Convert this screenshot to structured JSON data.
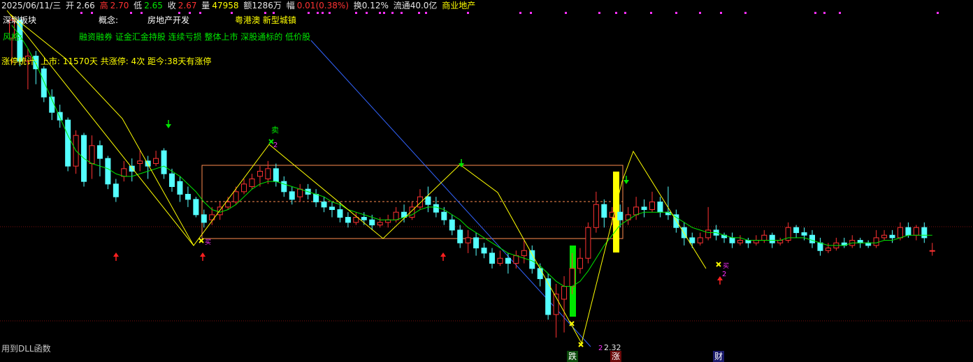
{
  "header": {
    "date": "2025/06/11/三",
    "open_label": "开",
    "open": "2.66",
    "high_label": "高",
    "high": "2.70",
    "low_label": "低",
    "low": "2.65",
    "close_label": "收",
    "close": "2.67",
    "vol_label": "量",
    "vol": "47958",
    "amount": "额1286万",
    "change_label": "幅",
    "change": "0.01(0.38%)",
    "turnover": "换0.12%",
    "float_cap": "流通40.0亿",
    "industry": "商业地产"
  },
  "info": {
    "region_label": "深圳板块",
    "concept_label": "概念:",
    "concept1": "房地产开发",
    "concept2": "粤港澳 新型城镇",
    "style_label": "风格:",
    "style_items": "融资融券 证金汇金持股 连续亏损 整体上市 深股通标的 低价股",
    "stats": "涨停统计: 上市: 11570天   共涨停: 4次   距今:38天有涨停"
  },
  "bottom_left": "用到DLL函数",
  "signals": {
    "sell": "卖",
    "buy": "买",
    "count2": "2",
    "low_price": "2.32"
  },
  "events": [
    {
      "label": "跌",
      "color": "#00c800"
    },
    {
      "label": "涨",
      "color": "#ff2020"
    },
    {
      "label": "财",
      "color": "#4060ff"
    }
  ],
  "colors": {
    "up": "#ff3232",
    "down": "#54ffff",
    "ma": "#00e600",
    "zigzag": "#ffff00",
    "box": "#ff8c50",
    "trend": "#3264ff",
    "arrow_up": "#ff2020",
    "arrow_down": "#00e600"
  },
  "chart_data": {
    "type": "candlestick",
    "date_last": "2025/06/11",
    "candles": [
      [
        3.5,
        3.57,
        3.59,
        3.4
      ],
      [
        3.57,
        3.41,
        3.58,
        3.39
      ],
      [
        3.41,
        3.43,
        3.46,
        3.3
      ],
      [
        3.43,
        3.38,
        3.45,
        3.32
      ],
      [
        3.38,
        3.27,
        3.39,
        3.25
      ],
      [
        3.27,
        3.21,
        3.3,
        3.18
      ],
      [
        3.21,
        3.18,
        3.24,
        3.15
      ],
      [
        3.18,
        3.0,
        3.19,
        2.98
      ],
      [
        3.0,
        3.12,
        3.14,
        2.97
      ],
      [
        3.12,
        2.94,
        3.13,
        2.92
      ],
      [
        3.01,
        3.08,
        3.12,
        2.95
      ],
      [
        3.08,
        3.03,
        3.1,
        2.96
      ],
      [
        3.03,
        2.93,
        3.04,
        2.91
      ],
      [
        2.93,
        2.88,
        2.95,
        2.86
      ],
      [
        2.96,
        2.99,
        3.02,
        2.94
      ],
      [
        3.0,
        2.98,
        3.03,
        2.94
      ],
      [
        3.01,
        3.02,
        3.06,
        2.98
      ],
      [
        3.02,
        3.0,
        3.04,
        2.95
      ],
      [
        3.01,
        3.03,
        3.06,
        3.0
      ],
      [
        3.06,
        2.97,
        3.07,
        2.95
      ],
      [
        2.97,
        2.92,
        2.99,
        2.9
      ],
      [
        2.94,
        2.89,
        2.96,
        2.86
      ],
      [
        2.89,
        2.87,
        2.92,
        2.84
      ],
      [
        2.87,
        2.81,
        2.88,
        2.8
      ],
      [
        2.81,
        2.78,
        2.83,
        2.76
      ],
      [
        2.79,
        2.81,
        2.84,
        2.77
      ],
      [
        2.81,
        2.84,
        2.86,
        2.79
      ],
      [
        2.84,
        2.86,
        2.88,
        2.83
      ],
      [
        2.86,
        2.9,
        2.92,
        2.85
      ],
      [
        2.9,
        2.93,
        2.95,
        2.89
      ],
      [
        2.92,
        2.95,
        2.97,
        2.91
      ],
      [
        2.96,
        2.98,
        3.0,
        2.92
      ],
      [
        2.95,
        2.99,
        3.02,
        2.93
      ],
      [
        2.99,
        2.94,
        3.01,
        2.92
      ],
      [
        2.94,
        2.9,
        2.96,
        2.88
      ],
      [
        2.9,
        2.87,
        2.92,
        2.85
      ],
      [
        2.88,
        2.91,
        2.93,
        2.86
      ],
      [
        2.91,
        2.89,
        2.93,
        2.87
      ],
      [
        2.89,
        2.86,
        2.91,
        2.84
      ],
      [
        2.86,
        2.84,
        2.88,
        2.82
      ],
      [
        2.84,
        2.83,
        2.86,
        2.8
      ],
      [
        2.83,
        2.8,
        2.86,
        2.78
      ],
      [
        2.8,
        2.78,
        2.82,
        2.76
      ],
      [
        2.78,
        2.8,
        2.82,
        2.77
      ],
      [
        2.8,
        2.79,
        2.82,
        2.77
      ],
      [
        2.79,
        2.77,
        2.81,
        2.75
      ],
      [
        2.77,
        2.78,
        2.8,
        2.76
      ],
      [
        2.78,
        2.79,
        2.81,
        2.76
      ],
      [
        2.79,
        2.82,
        2.84,
        2.78
      ],
      [
        2.82,
        2.8,
        2.85,
        2.78
      ],
      [
        2.8,
        2.84,
        2.86,
        2.79
      ],
      [
        2.84,
        2.88,
        2.91,
        2.83
      ],
      [
        2.88,
        2.85,
        2.92,
        2.82
      ],
      [
        2.85,
        2.82,
        2.88,
        2.8
      ],
      [
        2.82,
        2.79,
        2.84,
        2.77
      ],
      [
        2.79,
        2.75,
        2.81,
        2.73
      ],
      [
        2.75,
        2.7,
        2.77,
        2.68
      ],
      [
        2.7,
        2.72,
        2.75,
        2.66
      ],
      [
        2.72,
        2.68,
        2.74,
        2.65
      ],
      [
        2.68,
        2.66,
        2.7,
        2.64
      ],
      [
        2.66,
        2.62,
        2.68,
        2.6
      ],
      [
        2.62,
        2.64,
        2.67,
        2.61
      ],
      [
        2.64,
        2.62,
        2.66,
        2.58
      ],
      [
        2.62,
        2.65,
        2.67,
        2.6
      ],
      [
        2.65,
        2.67,
        2.71,
        2.62
      ],
      [
        2.67,
        2.6,
        2.69,
        2.58
      ],
      [
        2.6,
        2.56,
        2.62,
        2.53
      ],
      [
        2.56,
        2.42,
        2.58,
        2.4
      ],
      [
        2.42,
        2.5,
        2.54,
        2.33
      ],
      [
        2.48,
        2.53,
        2.57,
        2.35
      ],
      [
        2.53,
        2.6,
        2.66,
        2.5
      ],
      [
        2.6,
        2.64,
        2.68,
        2.58
      ],
      [
        2.64,
        2.76,
        2.78,
        2.62
      ],
      [
        2.76,
        2.85,
        2.9,
        2.74
      ],
      [
        2.85,
        2.8,
        2.87,
        2.76
      ],
      [
        2.8,
        2.82,
        2.84,
        2.77
      ],
      [
        2.82,
        2.79,
        2.85,
        2.76
      ],
      [
        2.79,
        2.81,
        2.84,
        2.77
      ],
      [
        2.81,
        2.84,
        2.88,
        2.79
      ],
      [
        2.84,
        2.83,
        2.87,
        2.8
      ],
      [
        2.83,
        2.86,
        2.9,
        2.82
      ],
      [
        2.86,
        2.82,
        2.88,
        2.8
      ],
      [
        2.82,
        2.81,
        2.92,
        2.79
      ],
      [
        2.81,
        2.76,
        2.83,
        2.74
      ],
      [
        2.76,
        2.72,
        2.78,
        2.69
      ],
      [
        2.72,
        2.7,
        2.74,
        2.68
      ],
      [
        2.7,
        2.72,
        2.74,
        2.69
      ],
      [
        2.72,
        2.75,
        2.84,
        2.71
      ],
      [
        2.75,
        2.73,
        2.77,
        2.71
      ],
      [
        2.73,
        2.72,
        2.74,
        2.7
      ],
      [
        2.72,
        2.7,
        2.74,
        2.68
      ],
      [
        2.7,
        2.71,
        2.73,
        2.69
      ],
      [
        2.71,
        2.7,
        2.72,
        2.68
      ],
      [
        2.7,
        2.71,
        2.73,
        2.69
      ],
      [
        2.71,
        2.73,
        2.75,
        2.7
      ],
      [
        2.73,
        2.7,
        2.74,
        2.68
      ],
      [
        2.7,
        2.71,
        2.72,
        2.69
      ],
      [
        2.71,
        2.76,
        2.78,
        2.7
      ],
      [
        2.76,
        2.74,
        2.77,
        2.72
      ],
      [
        2.74,
        2.73,
        2.76,
        2.71
      ],
      [
        2.73,
        2.7,
        2.75,
        2.68
      ],
      [
        2.7,
        2.67,
        2.72,
        2.65
      ],
      [
        2.67,
        2.68,
        2.7,
        2.66
      ],
      [
        2.68,
        2.7,
        2.72,
        2.67
      ],
      [
        2.7,
        2.69,
        2.72,
        2.68
      ],
      [
        2.69,
        2.71,
        2.73,
        2.68
      ],
      [
        2.71,
        2.7,
        2.72,
        2.68
      ],
      [
        2.7,
        2.69,
        2.71,
        2.68
      ],
      [
        2.69,
        2.72,
        2.75,
        2.68
      ],
      [
        2.72,
        2.73,
        2.75,
        2.71
      ],
      [
        2.73,
        2.72,
        2.75,
        2.7
      ],
      [
        2.72,
        2.76,
        2.78,
        2.71
      ],
      [
        2.76,
        2.73,
        2.78,
        2.72
      ],
      [
        2.73,
        2.76,
        2.77,
        2.71
      ],
      [
        2.76,
        2.72,
        2.78,
        2.7
      ],
      [
        2.67,
        2.67,
        2.7,
        2.65
      ]
    ],
    "ma": [
      3.55,
      3.51,
      3.46,
      3.4,
      3.33,
      3.26,
      3.19,
      3.12,
      3.06,
      3.03,
      3.01,
      3.0,
      2.99,
      2.97,
      2.96,
      2.96,
      2.97,
      2.98,
      2.99,
      3.0,
      2.98,
      2.96,
      2.93,
      2.9,
      2.86,
      2.83,
      2.82,
      2.83,
      2.85,
      2.88,
      2.91,
      2.93,
      2.94,
      2.94,
      2.93,
      2.92,
      2.91,
      2.9,
      2.89,
      2.88,
      2.86,
      2.85,
      2.83,
      2.82,
      2.81,
      2.8,
      2.79,
      2.79,
      2.79,
      2.8,
      2.81,
      2.83,
      2.84,
      2.84,
      2.83,
      2.81,
      2.79,
      2.76,
      2.74,
      2.72,
      2.7,
      2.68,
      2.66,
      2.65,
      2.64,
      2.63,
      2.61,
      2.58,
      2.55,
      2.53,
      2.53,
      2.55,
      2.59,
      2.64,
      2.69,
      2.73,
      2.77,
      2.79,
      2.81,
      2.82,
      2.82,
      2.82,
      2.82,
      2.8,
      2.78,
      2.76,
      2.75,
      2.74,
      2.74,
      2.73,
      2.72,
      2.72,
      2.71,
      2.71,
      2.71,
      2.71,
      2.71,
      2.72,
      2.72,
      2.72,
      2.71,
      2.7,
      2.69,
      2.69,
      2.69,
      2.7,
      2.7,
      2.7,
      2.7,
      2.71,
      2.71,
      2.72,
      2.73,
      2.73,
      2.73,
      2.73
    ]
  }
}
